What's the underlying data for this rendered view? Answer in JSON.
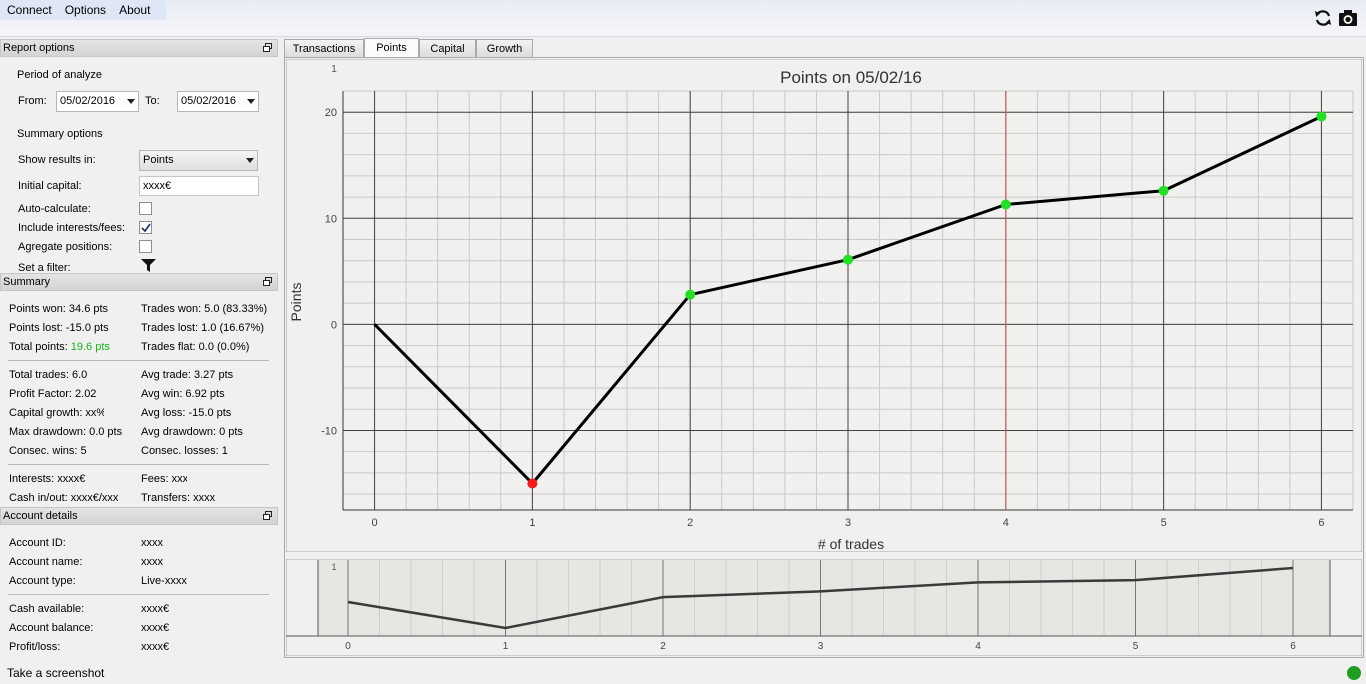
{
  "menu": [
    "Connect",
    "Options",
    "About"
  ],
  "toolbar": {
    "refresh_icon": "refresh-icon",
    "camera_icon": "camera-icon"
  },
  "report_options": {
    "header": "Report options",
    "period_label": "Period of analyze",
    "from_label": "From:",
    "from_value": "05/02/2016",
    "to_label": "To:",
    "to_value": "05/02/2016",
    "summary_options_label": "Summary options",
    "show_results_label": "Show results in:",
    "show_results_value": "Points",
    "initial_capital_label": "Initial capital:",
    "initial_capital_value": "xxxx€",
    "auto_calculate_label": "Auto-calculate:",
    "auto_calculate_checked": false,
    "include_fees_label": "Include interests/fees:",
    "include_fees_checked": true,
    "aggregate_label": "Agregate positions:",
    "aggregate_checked": false,
    "filter_label": "Set a filter:"
  },
  "summary": {
    "header": "Summary",
    "points_won": "Points won: 34.6 pts",
    "points_lost": "Points lost: -15.0 pts",
    "total_points_label": "Total points:",
    "total_points_value": "19.6 pts",
    "trades_won": "Trades won: 5.0 (83.33%)",
    "trades_lost": "Trades lost: 1.0 (16.67%)",
    "trades_flat": "Trades flat: 0.0 (0.0%)",
    "total_trades": "Total trades: 6.0",
    "profit_factor": "Profit Factor: 2.02",
    "capital_growth": "Capital growth: xx%",
    "max_drawdown": "Max drawdown: 0.0 pts",
    "consec_wins": "Consec. wins: 5",
    "avg_trade": "Avg trade: 3.27 pts",
    "avg_win": "Avg win: 6.92 pts",
    "avg_loss": "Avg loss: -15.0 pts",
    "avg_drawdown": "Avg drawdown: 0 pts",
    "consec_losses": "Consec. losses: 1",
    "interests": "Interests: xxxx€",
    "fees": "Fees: xxx",
    "cash_inout": "Cash in/out: xxxx€/xxx",
    "transfers": "Transfers: xxxx"
  },
  "account": {
    "header": "Account details",
    "id_label": "Account ID:",
    "id_value": "xxxx",
    "name_label": "Account name:",
    "name_value": "xxxx",
    "type_label": "Account type:",
    "type_value": "Live-xxxx",
    "cash_label": "Cash available:",
    "cash_value": "xxxx€",
    "balance_label": "Account balance:",
    "balance_value": "xxxx€",
    "pl_label": "Profit/loss:",
    "pl_value": "xxxx€"
  },
  "tabs": [
    "Transactions",
    "Points",
    "Capital",
    "Growth"
  ],
  "active_tab": "Points",
  "status": {
    "text": "Take a screenshot",
    "indicator_color": "#1e9e1e"
  },
  "colors": {
    "win": "#22e022",
    "loss": "#ff1a1a",
    "cursor_line": "#e06060",
    "total_points": "#18b418"
  },
  "chart_data": [
    {
      "type": "line",
      "title": "Points on 05/02/16",
      "xlabel": "# of trades",
      "ylabel": "Points",
      "x": [
        0,
        1,
        2,
        3,
        4,
        5,
        6
      ],
      "values": [
        0,
        -15.0,
        2.8,
        6.1,
        11.3,
        12.6,
        19.6
      ],
      "markers": [
        "none",
        "loss",
        "win",
        "win",
        "win",
        "win",
        "win"
      ],
      "xlim": [
        -0.2,
        6.2
      ],
      "ylim": [
        -17.5,
        22
      ],
      "yticks": [
        -10,
        0,
        10,
        20
      ],
      "xticks": [
        0,
        1,
        2,
        3,
        4,
        5,
        6
      ],
      "highlight_x": 4,
      "grid": true,
      "corner_label": "1"
    },
    {
      "type": "line",
      "title": "",
      "x": [
        0,
        1,
        2,
        3,
        4,
        5,
        6
      ],
      "values": [
        0,
        -15.0,
        2.8,
        6.1,
        11.3,
        12.6,
        19.6
      ],
      "xticks": [
        0,
        1,
        2,
        3,
        4,
        5,
        6
      ],
      "grid": true,
      "corner_label": "1"
    }
  ]
}
